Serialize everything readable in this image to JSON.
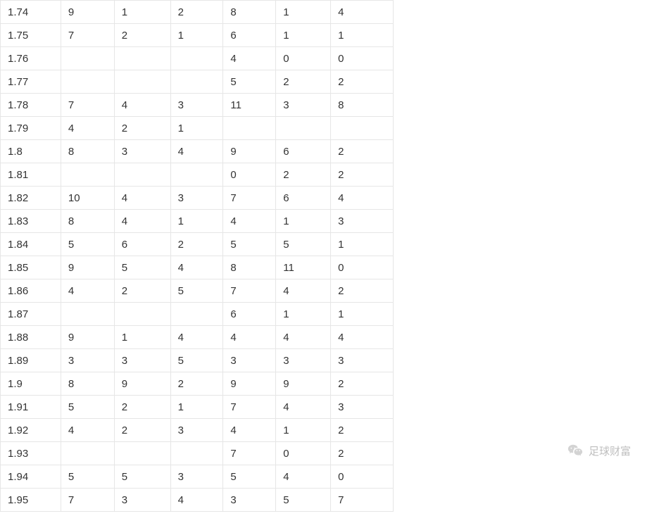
{
  "columns": 7,
  "rows": [
    [
      "1.74",
      "9",
      "1",
      "2",
      "8",
      "1",
      "4"
    ],
    [
      "1.75",
      "7",
      "2",
      "1",
      "6",
      "1",
      "1"
    ],
    [
      "1.76",
      "",
      "",
      "",
      "4",
      "0",
      "0"
    ],
    [
      "1.77",
      "",
      "",
      "",
      "5",
      "2",
      "2"
    ],
    [
      "1.78",
      "7",
      "4",
      "3",
      "11",
      "3",
      "8"
    ],
    [
      "1.79",
      "4",
      "2",
      "1",
      "",
      "",
      ""
    ],
    [
      "1.8",
      "8",
      "3",
      "4",
      "9",
      "6",
      "2"
    ],
    [
      "1.81",
      "",
      "",
      "",
      "0",
      "2",
      "2"
    ],
    [
      "1.82",
      "10",
      "4",
      "3",
      "7",
      "6",
      "4"
    ],
    [
      "1.83",
      "8",
      "4",
      "1",
      "4",
      "1",
      "3"
    ],
    [
      "1.84",
      "5",
      "6",
      "2",
      "5",
      "5",
      "1"
    ],
    [
      "1.85",
      "9",
      "5",
      "4",
      "8",
      "11",
      "0"
    ],
    [
      "1.86",
      "4",
      "2",
      "5",
      "7",
      "4",
      "2"
    ],
    [
      "1.87",
      "",
      "",
      "",
      "6",
      "1",
      "1"
    ],
    [
      "1.88",
      "9",
      "1",
      "4",
      "4",
      "4",
      "4"
    ],
    [
      "1.89",
      "3",
      "3",
      "5",
      "3",
      "3",
      "3"
    ],
    [
      "1.9",
      "8",
      "9",
      "2",
      "9",
      "9",
      "2"
    ],
    [
      "1.91",
      "5",
      "2",
      "1",
      "7",
      "4",
      "3"
    ],
    [
      "1.92",
      "4",
      "2",
      "3",
      "4",
      "1",
      "2"
    ],
    [
      "1.93",
      "",
      "",
      "",
      "7",
      "0",
      "2"
    ],
    [
      "1.94",
      "5",
      "5",
      "3",
      "5",
      "4",
      "0"
    ],
    [
      "1.95",
      "7",
      "3",
      "4",
      "3",
      "5",
      "7"
    ]
  ],
  "watermark": {
    "text": "足球财富"
  }
}
